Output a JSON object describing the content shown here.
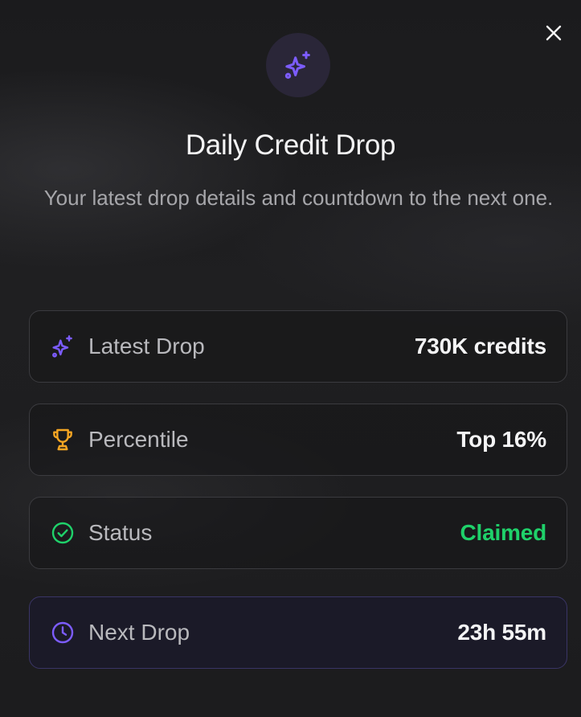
{
  "modal": {
    "title": "Daily Credit Drop",
    "subtitle": "Your latest drop details and countdown to the next one.",
    "close_icon": "close-icon",
    "hero_icon": "sparkles-icon"
  },
  "rows": [
    {
      "label": "Latest Drop",
      "value": "730K credits",
      "icon": "sparkles-icon",
      "icon_color": "#7c5cff"
    },
    {
      "label": "Percentile",
      "value": "Top 16%",
      "icon": "trophy-icon",
      "icon_color": "#f5a623"
    },
    {
      "label": "Status",
      "value": "Claimed",
      "icon": "check-circle-icon",
      "icon_color": "#1fd16a",
      "value_color": "#1fd16a"
    },
    {
      "label": "Next Drop",
      "value": "23h 55m",
      "icon": "clock-icon",
      "icon_color": "#7c5cff"
    }
  ],
  "colors": {
    "accent": "#7c5cff",
    "success": "#1fd16a",
    "gold": "#f5a623"
  }
}
